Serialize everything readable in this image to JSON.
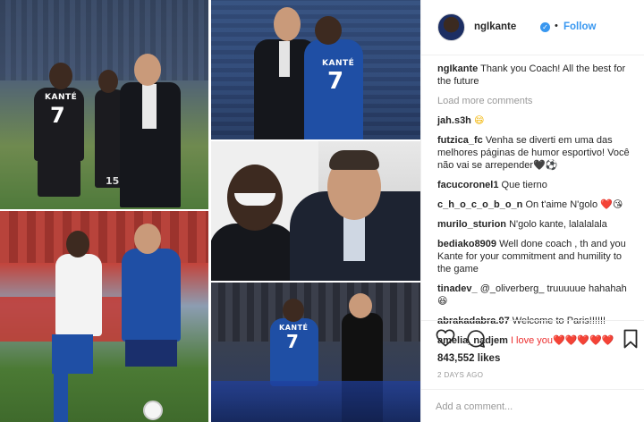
{
  "post": {
    "author": "ngIkante",
    "verified": true,
    "separator": "•",
    "follow_label": "Follow",
    "caption_user": "ngIkante",
    "caption_text": "Thank you Coach! All the best for the future",
    "load_more_label": "Load more comments",
    "comments": [
      {
        "user": "jah.s3h",
        "text": "😄"
      },
      {
        "user": "futzica_fc",
        "text": "Venha se diverti em uma das melhores páginas de humor esportivo! Você não vai se arrepender🖤⚽"
      },
      {
        "user": "facucoronel1",
        "text": "Que tierno"
      },
      {
        "user": "c_h_o_c_o_b_o_n",
        "text": "On t'aime N'golo ❤️😘"
      },
      {
        "user": "murilo_sturion",
        "text": "N'golo kante, lalalalala"
      },
      {
        "user": "bediako8909",
        "text": "Well done coach , th and you Kante for your commitment and humility to the game"
      },
      {
        "user": "tinadev_",
        "text": "@_oliverberg_ truuuuue hahahah 😆"
      },
      {
        "user": "abrakadabra.07",
        "text": "Welcome to Paris!!!!!!"
      },
      {
        "user": "amelia_nadjem",
        "text": "I love you❤️❤️❤️❤️❤️"
      }
    ],
    "likes": "843,552 likes",
    "posted": "2 DAYS AGO",
    "comment_placeholder": "Add a comment..."
  },
  "photos": {
    "p1": {
      "jersey_name": "KANTÉ",
      "jersey_number": "7",
      "other_number": "15"
    },
    "p2": {
      "jersey_name": "KANTÉ",
      "jersey_number": "7"
    },
    "p5": {
      "jersey_name": "KANTÉ",
      "jersey_number": "7"
    }
  },
  "icons": [
    "verified-badge-icon",
    "heart-icon",
    "comment-icon",
    "bookmark-icon"
  ],
  "colors": {
    "link": "#3897f0",
    "text": "#262626",
    "muted": "#999999",
    "divider": "#efefef"
  }
}
